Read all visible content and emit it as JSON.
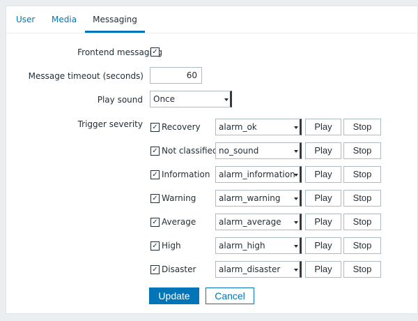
{
  "tabs": [
    {
      "label": "User"
    },
    {
      "label": "Media"
    },
    {
      "label": "Messaging"
    }
  ],
  "form": {
    "frontend_messaging_label": "Frontend messaging",
    "message_timeout_label": "Message timeout (seconds)",
    "message_timeout_value": "60",
    "play_sound_label": "Play sound",
    "play_sound_value": "Once",
    "trigger_severity_label": "Trigger severity",
    "play_label": "Play",
    "stop_label": "Stop"
  },
  "severities": [
    {
      "label": "Recovery",
      "sound": "alarm_ok"
    },
    {
      "label": "Not classified",
      "sound": "no_sound"
    },
    {
      "label": "Information",
      "sound": "alarm_information"
    },
    {
      "label": "Warning",
      "sound": "alarm_warning"
    },
    {
      "label": "Average",
      "sound": "alarm_average"
    },
    {
      "label": "High",
      "sound": "alarm_high"
    },
    {
      "label": "Disaster",
      "sound": "alarm_disaster"
    }
  ],
  "actions": {
    "update_label": "Update",
    "cancel_label": "Cancel"
  },
  "colors": {
    "accent": "#0275b8",
    "background": "#ebeef0",
    "text": "#1f2c33"
  }
}
